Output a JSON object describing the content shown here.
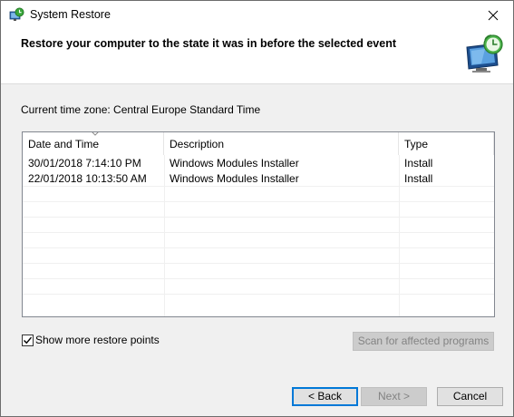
{
  "window": {
    "title": "System Restore",
    "icon": "system-restore-icon",
    "close_icon": "close-icon"
  },
  "header": {
    "title": "Restore your computer to the state it was in before the selected event",
    "icon": "restore-monitor-clock-icon"
  },
  "timezone_text": "Current time zone: Central Europe Standard Time",
  "table": {
    "columns": [
      {
        "label": "Date and Time",
        "sorted": "descending"
      },
      {
        "label": "Description"
      },
      {
        "label": "Type"
      }
    ],
    "rows": [
      {
        "date": "30/01/2018 7:14:10 PM",
        "description": "Windows Modules Installer",
        "type": "Install"
      },
      {
        "date": "22/01/2018 10:13:50 AM",
        "description": "Windows Modules Installer",
        "type": "Install"
      }
    ]
  },
  "show_more": {
    "label": "Show more restore points",
    "checked": true
  },
  "buttons": {
    "scan": "Scan for affected programs",
    "back": "< Back",
    "next": "Next >",
    "cancel": "Cancel"
  },
  "colors": {
    "accent": "#0078d7",
    "disabled_text": "#838383"
  }
}
